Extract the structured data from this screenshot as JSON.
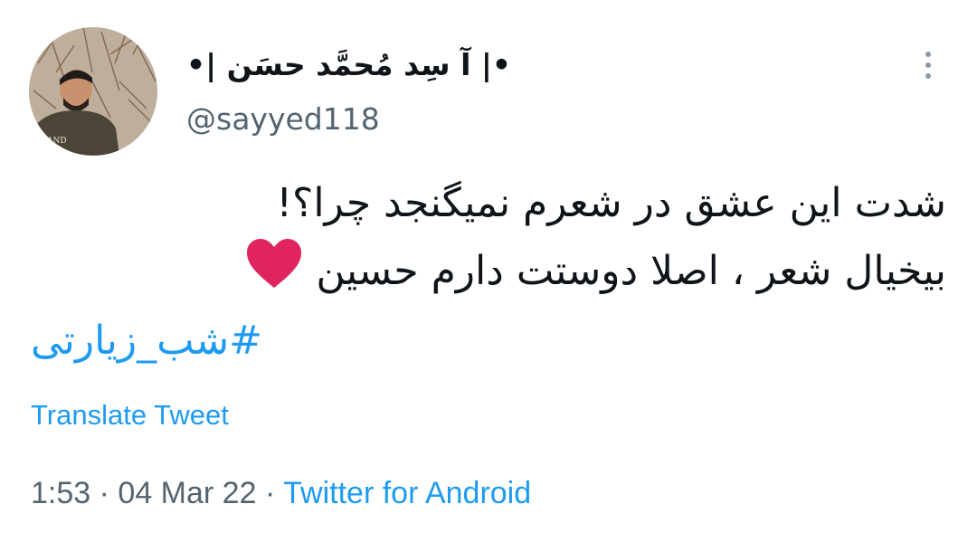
{
  "tweet": {
    "display_name": "•| آ سِد مُحمَّد حسَن |•",
    "handle": "@sayyed118",
    "body_lines": [
      "شدت این عشق در شعرم نمیگنجد چرا؟!",
      "بیخیال شعر ، اصلا دوستت دارم حسین"
    ],
    "hashtag": "#شب_زیارتی",
    "translate_label": "Translate Tweet",
    "time": "1:53",
    "separator": "·",
    "date": "04 Mar 22",
    "source": "Twitter for Android",
    "more_icon": "more-vertical-icon",
    "heart_emoji": "heart-icon"
  },
  "colors": {
    "link": "#1d9bf0",
    "secondary_text": "#536471",
    "primary_text": "#0f1419",
    "heart": "#e0245e"
  }
}
